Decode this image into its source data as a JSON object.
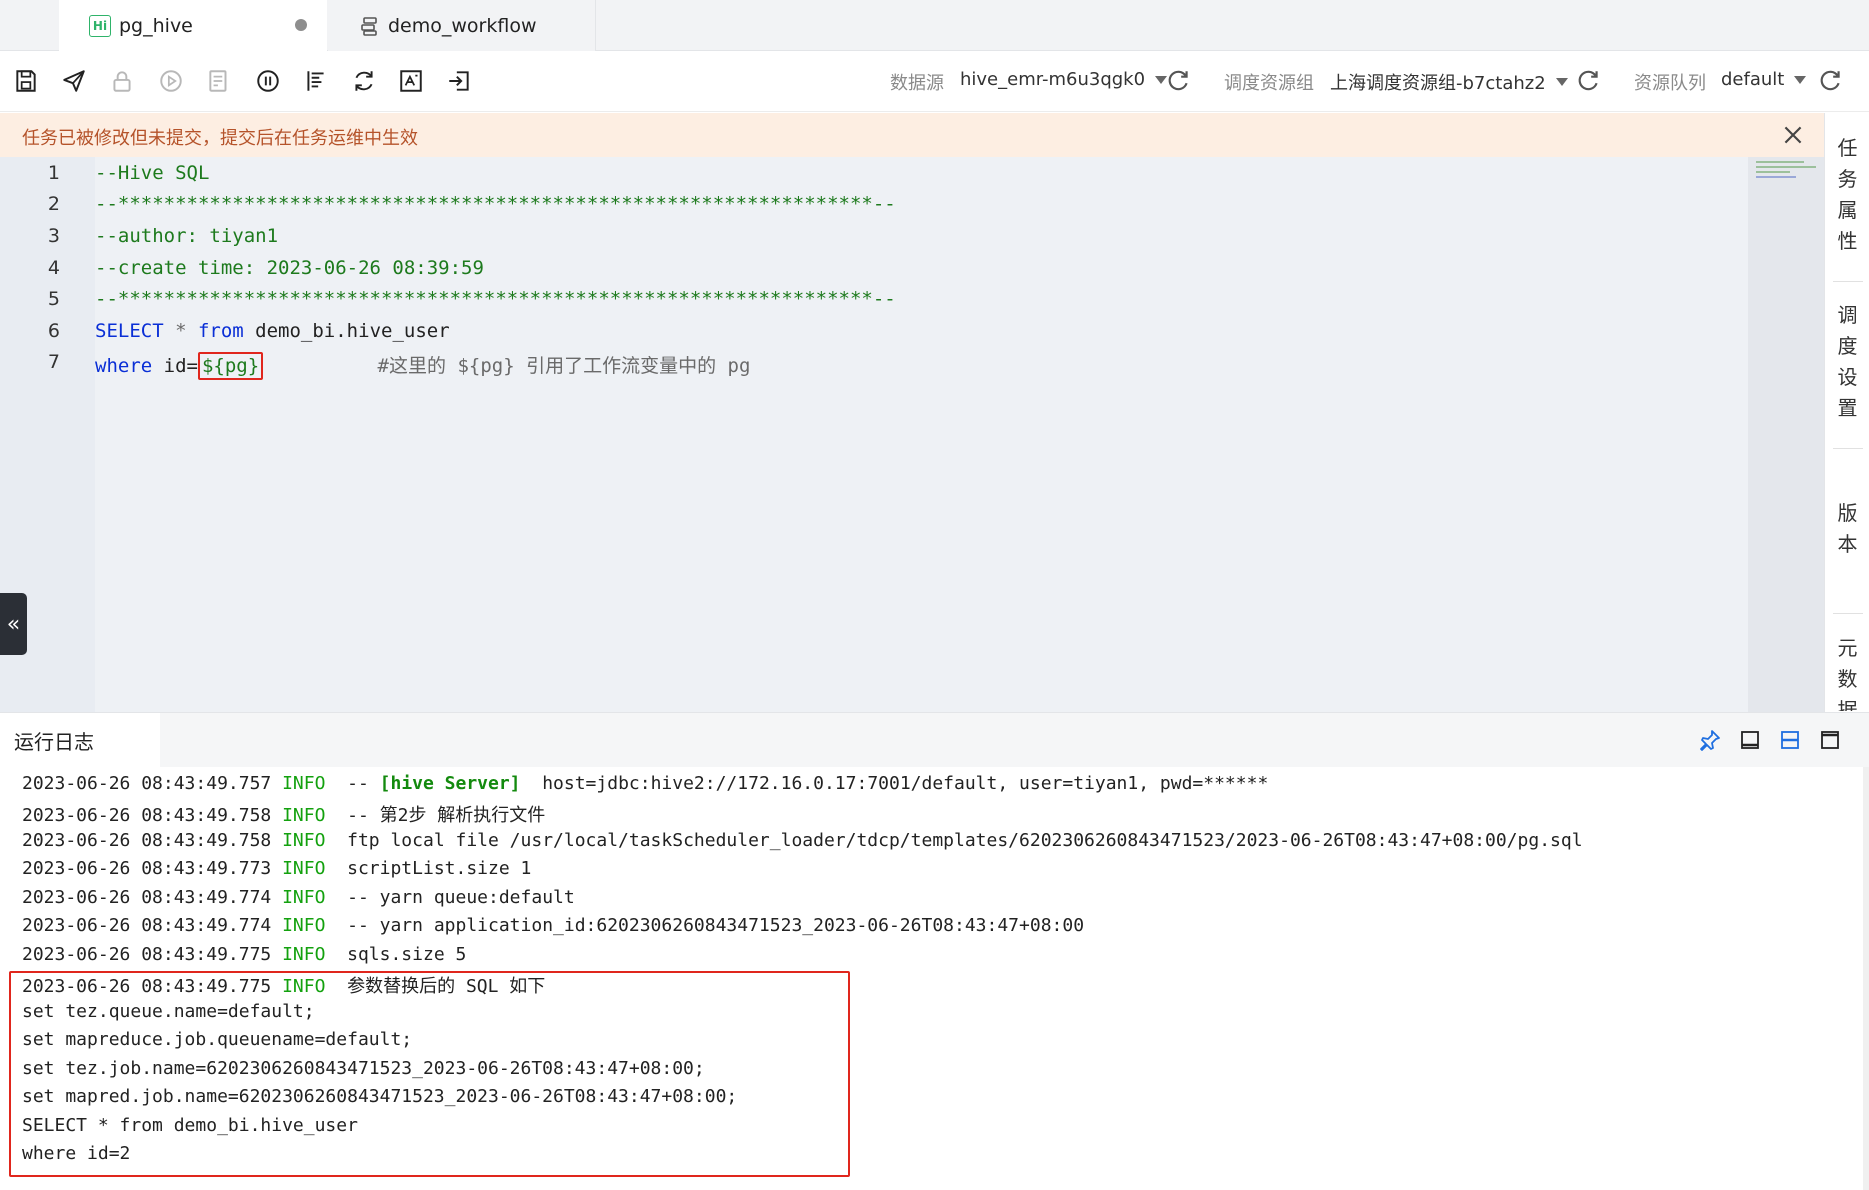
{
  "tabs": [
    {
      "label": "pg_hive",
      "icon": "hive-file-icon",
      "icon_text": "Hi",
      "active": true,
      "modified": true
    },
    {
      "label": "demo_workflow",
      "icon": "workflow-icon",
      "active": false
    }
  ],
  "toolbar": {
    "buttons": [
      "save-icon",
      "submit-icon",
      "lock-icon",
      "run-icon",
      "run-with-params-icon",
      "pause-icon",
      "format-icon",
      "refresh-icon",
      "preview-icon",
      "exit-icon"
    ],
    "datasource_label": "数据源",
    "datasource_value": "hive_emr-m6u3qgk0",
    "resource_group_label": "调度资源组",
    "resource_group_value": "上海调度资源组-b7ctahz2",
    "queue_label": "资源队列",
    "queue_value": "default"
  },
  "banner": {
    "text": "任务已被修改但未提交，提交后在任务运维中生效"
  },
  "editor": {
    "lines": [
      {
        "num": "1",
        "text": "--Hive SQL"
      },
      {
        "num": "2",
        "text": "--******************************************************************--"
      },
      {
        "num": "3",
        "text": "--author: tiyan1"
      },
      {
        "num": "4",
        "text": "--create time: 2023-06-26 08:39:59"
      },
      {
        "num": "5",
        "text": "--******************************************************************--"
      },
      {
        "num": "6",
        "kw1": "SELECT",
        "star": " * ",
        "kw2": "from",
        "rest": " demo_bi.hive_user"
      },
      {
        "num": "7",
        "kw1": "where",
        "mid": " id=",
        "var": "${pg}",
        "comment": "          #这里的 ${pg} 引用了工作流变量中的 pg"
      }
    ]
  },
  "sidepanel": {
    "items": [
      "任务属性",
      "调度设置",
      "版本",
      "元数据"
    ]
  },
  "log": {
    "title": "运行日志",
    "lines": [
      {
        "ts": "2023-06-26 08:43:49.757",
        "level": "INFO",
        "pre": "  -- ",
        "hl": "[hive Server]",
        "msg": "  host=jdbc:hive2://172.16.0.17:7001/default, user=tiyan1, pwd=******"
      },
      {
        "ts": "2023-06-26 08:43:49.758",
        "level": "INFO",
        "msg": "  -- 第2步 解析执行文件"
      },
      {
        "ts": "2023-06-26 08:43:49.758",
        "level": "INFO",
        "msg": "  ftp local file /usr/local/taskScheduler_loader/tdcp/templates/6202306260843471523/2023-06-26T08:43:47+08:00/pg.sql"
      },
      {
        "ts": "2023-06-26 08:43:49.773",
        "level": "INFO",
        "msg": "  scriptList.size 1"
      },
      {
        "ts": "2023-06-26 08:43:49.774",
        "level": "INFO",
        "msg": "  -- yarn queue:default"
      },
      {
        "ts": "2023-06-26 08:43:49.774",
        "level": "INFO",
        "msg": "  -- yarn application_id:6202306260843471523_2023-06-26T08:43:47+08:00"
      },
      {
        "ts": "2023-06-26 08:43:49.775",
        "level": "INFO",
        "msg": "  sqls.size 5"
      },
      {
        "ts": "2023-06-26 08:43:49.775",
        "level": "INFO",
        "msg": "  参数替换后的 SQL 如下"
      },
      {
        "plain": "set tez.queue.name=default;"
      },
      {
        "plain": "set mapreduce.job.queuename=default;"
      },
      {
        "plain": "set tez.job.name=6202306260843471523_2023-06-26T08:43:47+08:00;"
      },
      {
        "plain": "set mapred.job.name=6202306260843471523_2023-06-26T08:43:47+08:00;"
      },
      {
        "plain": "SELECT * from demo_bi.hive_user"
      },
      {
        "plain": "where id=2"
      }
    ]
  },
  "colors": {
    "accent": "#1f6fe0",
    "highlight_red": "#e0261d",
    "sql_keyword": "#0a2fd6",
    "sql_comment": "#1d7a1d",
    "log_info": "#13a10e",
    "banner_bg": "#fdeee2",
    "banner_text": "#b5532a"
  }
}
